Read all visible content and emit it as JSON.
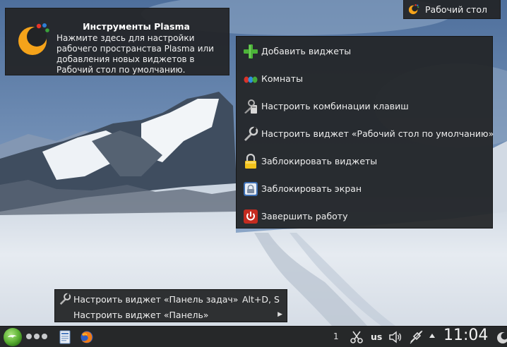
{
  "toolbox_tooltip": {
    "title": "Инструменты Plasma",
    "body": "Нажмите здесь для настройки рабочего пространства Plasma или добавления новых виджетов в Рабочий стол по умолчанию."
  },
  "desktop_label": {
    "text": "Рабочий стол"
  },
  "desktop_menu": {
    "items": [
      {
        "label": "Добавить виджеты",
        "icon": "plus-icon"
      },
      {
        "label": "Комнаты",
        "icon": "activities-icon"
      },
      {
        "label": "Настроить комбинации клавиш",
        "icon": "shortcuts-icon"
      },
      {
        "label": "Настроить виджет «Рабочий стол по умолчанию»",
        "icon": "wrench-icon"
      },
      {
        "label": "Заблокировать виджеты",
        "icon": "lock-icon"
      },
      {
        "label": "Заблокировать экран",
        "icon": "lock-screen-icon"
      },
      {
        "label": "Завершить работу",
        "icon": "power-icon"
      }
    ]
  },
  "panel_menu": {
    "items": [
      {
        "label": "Настроить виджет «Панель задач»",
        "shortcut": "Alt+D, S",
        "icon": "wrench-icon"
      },
      {
        "label": "Настроить виджет «Панель»",
        "has_submenu": true
      }
    ]
  },
  "taskbar": {
    "tray_count": "1",
    "keyboard_layout": "us",
    "clock": "11:04"
  },
  "colors": {
    "panel_bg": "#262829",
    "menu_bg": "#232527",
    "kde_green": "#5fb336",
    "plasma_orange": "#f5a31a"
  }
}
